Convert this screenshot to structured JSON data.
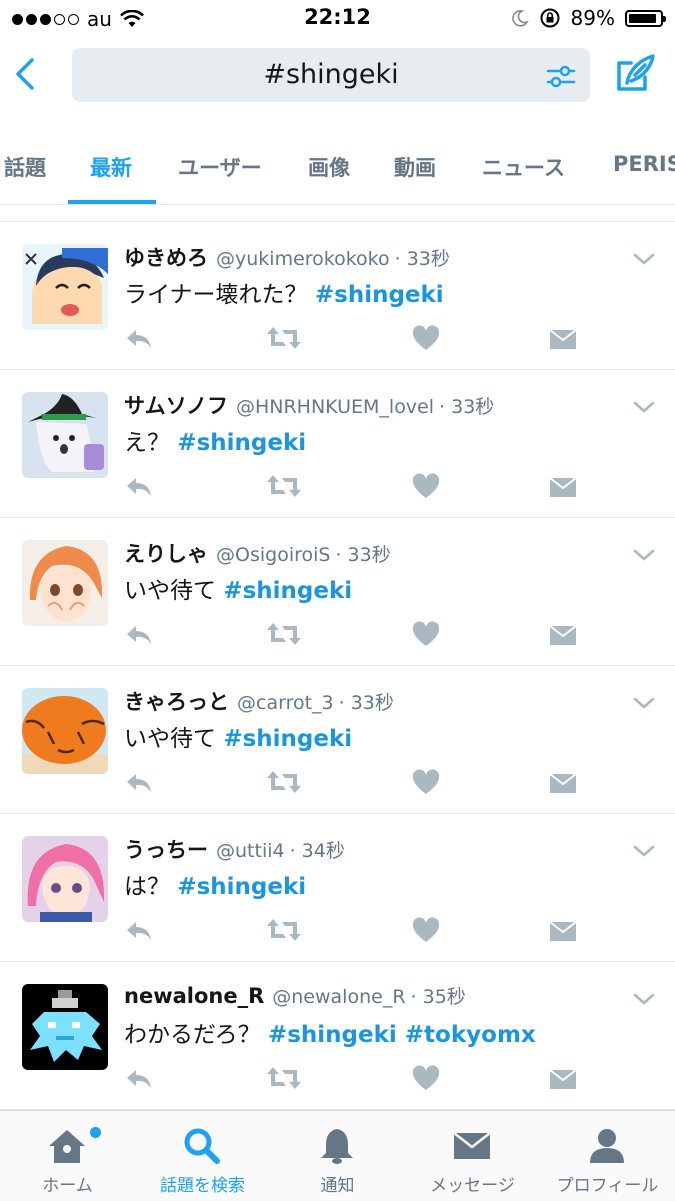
{
  "status": {
    "carrier": "au",
    "time": "22:12",
    "battery": "89%"
  },
  "search": {
    "query": "#shingeki"
  },
  "tabs": [
    "話題",
    "最新",
    "ユーザー",
    "画像",
    "動画",
    "ニュース",
    "PERIS"
  ],
  "tweets": [
    {
      "name": "ゆきめろ",
      "handle": "@yukimerokokoko",
      "time": "· 33秒",
      "text": "ライナー壊れた？",
      "tags": "#shingeki",
      "avatar": "chibi-boy-avatar"
    },
    {
      "name": "サムソノフ",
      "handle": "@HNRHNKUEM_lovel",
      "time": "· 33秒",
      "text": "え？",
      "tags": "#shingeki",
      "avatar": "ghost-witch-avatar"
    },
    {
      "name": "えりしゃ",
      "handle": "@OsigoiroiS",
      "time": "· 33秒",
      "text": "いや待て",
      "tags": "#shingeki",
      "avatar": "anime-girl-orange-avatar"
    },
    {
      "name": "きゃろっと",
      "handle": "@carrot_3",
      "time": "· 33秒",
      "text": "いや待て",
      "tags": "#shingeki",
      "avatar": "pumpkin-avatar"
    },
    {
      "name": "うっちー",
      "handle": "@uttii4",
      "time": "· 34秒",
      "text": "は？",
      "tags": "#shingeki",
      "avatar": "anime-girl-pink-avatar"
    },
    {
      "name": "newalone_R",
      "handle": "@newalone_R",
      "time": "· 35秒",
      "text": "わかるだろ？",
      "tags": "#shingeki #tokyomx",
      "avatar": "pixel-art-avatar"
    }
  ],
  "bottom_nav": [
    "ホーム",
    "話題を検索",
    "通知",
    "メッセージ",
    "プロフィール"
  ],
  "colors": {
    "accent": "#1da1f2",
    "hashtag": "#1b95e0",
    "muted": "#657786",
    "icon": "#aab8c2"
  }
}
